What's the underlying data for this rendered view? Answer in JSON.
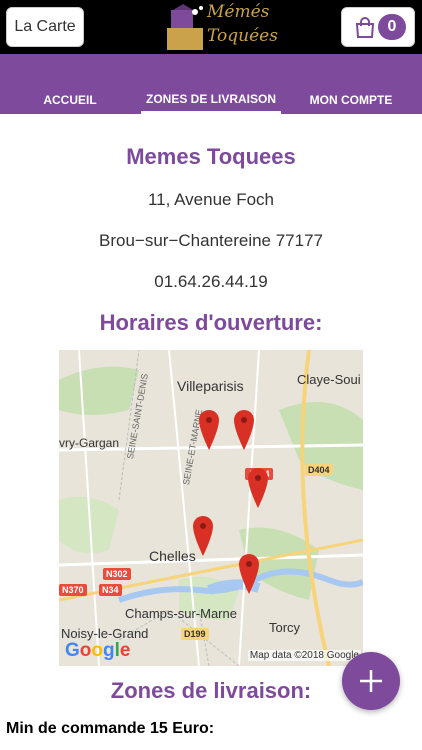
{
  "header": {
    "menu_button_label": "La Carte",
    "logo_line1": "Mémés",
    "logo_line2": "Toquées",
    "cart_count": "0"
  },
  "nav": {
    "tabs": [
      {
        "label": "ACCUEIL",
        "active": false
      },
      {
        "label": "ZONES DE LIVRAISON",
        "active": true
      },
      {
        "label": "MON COMPTE",
        "active": false
      }
    ]
  },
  "restaurant": {
    "name": "Memes Toquees",
    "street": "11, Avenue Foch",
    "city": "Brou−sur−Chantereine 77177",
    "phone": "01.64.26.44.19"
  },
  "sections": {
    "hours_title": "Horaires d'ouverture:",
    "zones_title": "Zones de livraison:",
    "min_order": "Min de commande 15 Euro:"
  },
  "map": {
    "labels": [
      "Villeparisis",
      "Claye-Soui",
      "vry-Gargan",
      "SEINE-SAINT-DENIS",
      "SEINE-ET-MARNE",
      "Chelles",
      "Champs-sur-Marne",
      "Noisy-le-Grand",
      "Torcy"
    ],
    "roads": [
      "A104",
      "D404",
      "N302",
      "N370",
      "N34",
      "D199"
    ],
    "logo": "Google",
    "attribution": "Map data ©2018 Google"
  },
  "fab": {
    "icon": "plus-icon"
  },
  "colors": {
    "brand": "#7d4a9c",
    "header_bg": "#000000"
  }
}
